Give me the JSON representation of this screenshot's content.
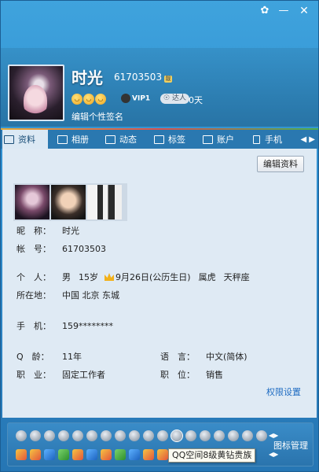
{
  "profile": {
    "nickname": "时光",
    "qq_number": "61703503",
    "vip_label": "VIP1",
    "daren_label": "达人",
    "days": "0天",
    "signature": "编辑个性签名"
  },
  "tabs": [
    {
      "label": "资料",
      "icon": "profile-card-icon",
      "active": true
    },
    {
      "label": "相册",
      "icon": "album-icon",
      "active": false
    },
    {
      "label": "动态",
      "icon": "feed-icon",
      "active": false
    },
    {
      "label": "标签",
      "icon": "tag-icon",
      "active": false
    },
    {
      "label": "账户",
      "icon": "wallet-icon",
      "active": false
    },
    {
      "label": "手机",
      "icon": "phone-icon",
      "active": false
    }
  ],
  "content": {
    "edit_button": "编辑资料",
    "nickname_label": "昵　称：",
    "nickname_value": "时光",
    "account_label": "帐　号：",
    "account_value": "61703503",
    "personal_label": "个　人：",
    "gender": "男",
    "age": "15岁",
    "birthday": "9月26日(公历生日)",
    "zodiac": "属虎",
    "constellation": "天秤座",
    "location_label": "所在地：",
    "location_value": "中国 北京 东城",
    "phone_label": "手　机：",
    "phone_value": "159********",
    "qage_label": "Q　龄：",
    "qage_value": "11年",
    "language_label": "语　言：",
    "language_value": "中文(简体)",
    "job_label": "职　业：",
    "job_value": "固定工作者",
    "position_label": "职　位：",
    "position_value": "销售",
    "permission_link": "权限设置"
  },
  "bottom": {
    "icon_management": "图标管理",
    "tooltip": "QQ空间8级黄钻贵族"
  }
}
